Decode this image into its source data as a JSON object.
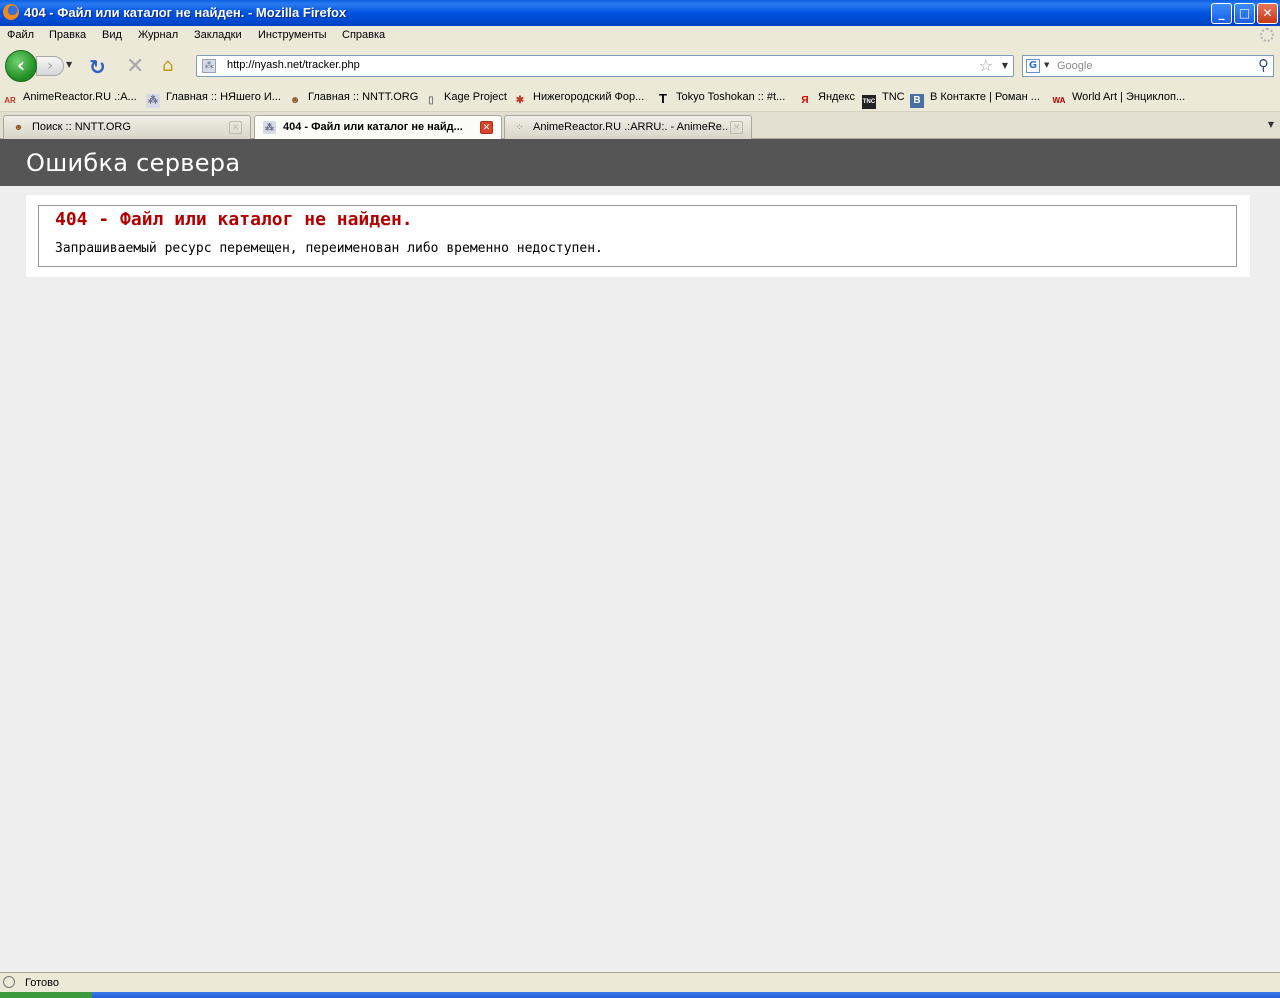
{
  "window": {
    "title": "404 - Файл или каталог не найден. - Mozilla Firefox",
    "controls": {
      "minimize": "_",
      "maximize": "□",
      "close": "✕"
    }
  },
  "menu": {
    "items": [
      "Файл",
      "Правка",
      "Вид",
      "Журнал",
      "Закладки",
      "Инструменты",
      "Справка"
    ]
  },
  "nav": {
    "url": "http://nyash.net/tracker.php",
    "search_placeholder": "Google",
    "search_engine_icon": "G"
  },
  "bookmarks": [
    {
      "label": "AnimeReactor.RU .:A...",
      "icon": "AR",
      "color": "#c0392b"
    },
    {
      "label": "Главная :: НЯшего И...",
      "icon": "⁂",
      "color": "#6a6a8a"
    },
    {
      "label": "Главная :: NNTT.ORG",
      "icon": "☻",
      "color": "#8a5a2a"
    },
    {
      "label": "Kage Project",
      "icon": "▯",
      "color": "#777777"
    },
    {
      "label": "Нижегородский Фор...",
      "icon": "✱",
      "color": "#c0392b"
    },
    {
      "label": "Tokyo Toshokan :: #t...",
      "icon": "T",
      "color": "#000000"
    },
    {
      "label": "Яндекс",
      "icon": "Я",
      "color": "#d00000"
    },
    {
      "label": "TNC",
      "icon": "TNC",
      "color": "#222222"
    },
    {
      "label": "В Контакте | Роман ...",
      "icon": "B",
      "color": "#4a6fa5"
    },
    {
      "label": "World Art | Энциклоп...",
      "icon": "WA",
      "color": "#b00000"
    }
  ],
  "tabs": [
    {
      "label": "Поиск :: NNTT.ORG",
      "icon": "☻",
      "active": false
    },
    {
      "label": "404 - Файл или каталог не найд...",
      "icon": "⁂",
      "active": true
    },
    {
      "label": "AnimeReactor.RU .:ARRU:. - AnimeRe...",
      "icon": "⁘",
      "active": false
    }
  ],
  "page": {
    "header": "Ошибка сервера",
    "error_title": "404 - Файл или каталог не найден.",
    "error_message": "Запрашиваемый ресурс перемещен, переименован либо временно недоступен."
  },
  "status": {
    "text": "Готово"
  },
  "colors": {
    "header_bg": "#555555",
    "error_red": "#b20000",
    "content_bg": "#eeeeee"
  }
}
